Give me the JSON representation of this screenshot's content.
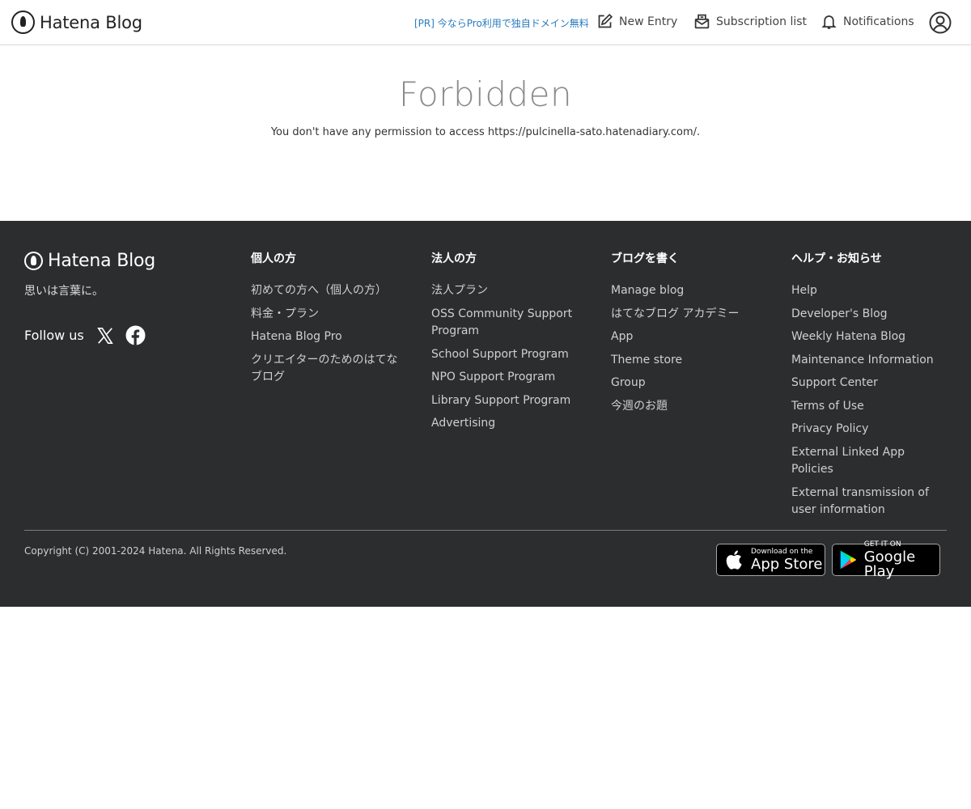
{
  "header": {
    "logo_text": "Hatena Blog",
    "pr_link": "[PR] 今ならPro利用で独自ドメイン無料",
    "new_entry": "New Entry",
    "subscription_list": "Subscription list",
    "notifications": "Notifications"
  },
  "main": {
    "title": "Forbidden",
    "message": "You don't have any permission to access https://pulcinella-sato.hatenadiary.com/."
  },
  "footer": {
    "logo_text": "Hatena Blog",
    "tagline": "思いは言葉に。",
    "follow_label": "Follow us",
    "columns": [
      {
        "heading": "個人の方",
        "items": [
          "初めての方へ（個人の方）",
          "料金・プラン",
          "Hatena Blog Pro",
          "クリエイターのためのはてなブログ"
        ]
      },
      {
        "heading": "法人の方",
        "items": [
          "法人プラン",
          "OSS Community Support Program",
          "School Support Program",
          "NPO Support Program",
          "Library Support Program",
          "Advertising"
        ]
      },
      {
        "heading": "ブログを書く",
        "items": [
          "Manage blog",
          "はてなブログ アカデミー",
          "App",
          "Theme store",
          "Group",
          "今週のお題"
        ]
      },
      {
        "heading": "ヘルプ・お知らせ",
        "items": [
          "Help",
          "Developer's Blog",
          "Weekly Hatena Blog",
          "Maintenance Information",
          "Support Center",
          "Terms of Use",
          "Privacy Policy",
          "External Linked App Policies",
          "External transmission of user information"
        ]
      }
    ],
    "copyright": "Copyright (C) 2001-2024 Hatena. All Rights Reserved.",
    "app_store": {
      "small": "Download on the",
      "big": "App Store"
    },
    "google_play": {
      "small": "GET IT ON",
      "big": "Google Play"
    }
  },
  "colors": {
    "footer_bg": "#2c2d2f",
    "pr_link": "#2a7bbf",
    "title_gray": "#8c8c8c"
  }
}
